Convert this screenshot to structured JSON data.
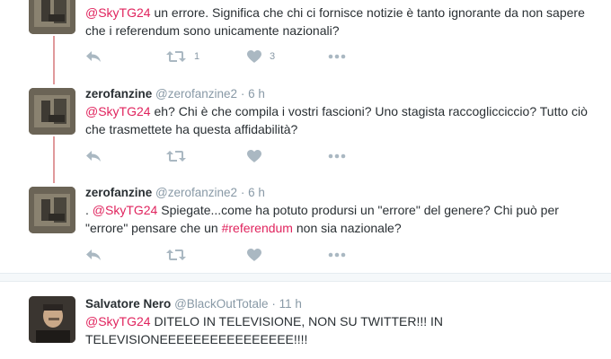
{
  "tweets": [
    {
      "fullname": "",
      "username": "",
      "time": "",
      "mention": "@SkyTG24",
      "text_after": " un errore. Significa che chi ci fornisce notizie è tanto ignorante da non sapere che i referendum sono unicamente nazionali?",
      "retweets": "1",
      "likes": "3"
    },
    {
      "fullname": "zerofanzine",
      "username": "@zerofanzine2",
      "dot": "·",
      "time": "6 h",
      "mention": "@SkyTG24",
      "text_after": " eh? Chi è che compila i vostri fascioni? Uno stagista raccoglicciccio? Tutto ciò che trasmettete ha questa affidabilità?"
    },
    {
      "fullname": "zerofanzine",
      "username": "@zerofanzine2",
      "dot": "·",
      "time": "6 h",
      "prefix": ". ",
      "mention": "@SkyTG24",
      "text_middle": " Spiegate...come ha potuto prodursi un \"errore\" del genere? Chi può per \"errore\" pensare che un ",
      "hashtag": "#referendum",
      "text_after": " non sia nazionale?"
    },
    {
      "fullname": "Salvatore Nero",
      "username": "@BlackOutTotale",
      "dot": "·",
      "time": "11 h",
      "mention": "@SkyTG24",
      "text_after": " DITELO IN TELEVISIONE, NON SU TWITTER!!! IN TELEVISIONEEEEEEEEEEEEEEEE!!!!"
    }
  ],
  "icons": {
    "reply": "reply-icon",
    "retweet": "retweet-icon",
    "like": "heart-icon",
    "more": "more-icon"
  },
  "colors": {
    "link": "#e0245e",
    "thread_line": "#e0999b",
    "icon": "#aab8c2",
    "meta": "#8899a6",
    "text": "#292f33"
  }
}
